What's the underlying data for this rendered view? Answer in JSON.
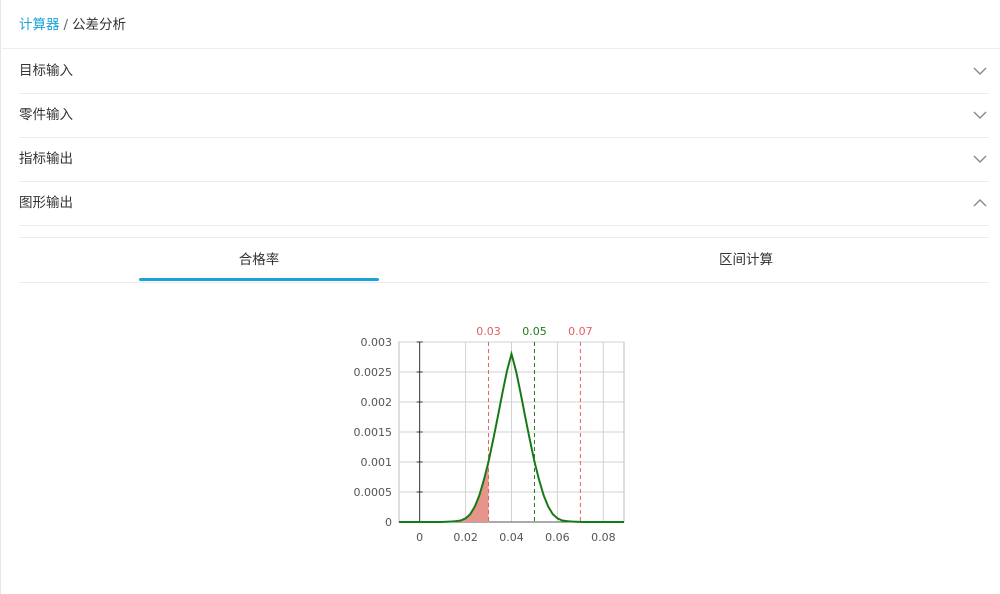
{
  "breadcrumb": {
    "root": "计算器",
    "separator": "/",
    "current": "公差分析"
  },
  "accordion": [
    {
      "label": "目标输入",
      "state": "collapsed"
    },
    {
      "label": "零件输入",
      "state": "collapsed"
    },
    {
      "label": "指标输出",
      "state": "collapsed"
    },
    {
      "label": "图形输出",
      "state": "expanded"
    }
  ],
  "tabs": [
    {
      "label": "合格率",
      "active": true
    },
    {
      "label": "区间计算",
      "active": false
    }
  ],
  "colors": {
    "accent": "#1aa4d6",
    "curve": "#177a17",
    "limit": "#e06060",
    "nominal": "#1f7a1f",
    "fill": "#e6958d"
  },
  "chart_data": {
    "type": "line",
    "title": "",
    "xlabel": "",
    "ylabel": "",
    "xlim": [
      -0.009,
      0.089
    ],
    "ylim": [
      0,
      0.003
    ],
    "x_ticks": [
      "0",
      "0.02",
      "0.04",
      "0.06",
      "0.08"
    ],
    "x_tick_values": [
      0,
      0.02,
      0.04,
      0.06,
      0.08
    ],
    "y_ticks": [
      "0",
      "0.0005",
      "0.001",
      "0.0015",
      "0.002",
      "0.0025",
      "0.003"
    ],
    "y_tick_values": [
      0,
      0.0005,
      0.001,
      0.0015,
      0.002,
      0.0025,
      0.003
    ],
    "grid": true,
    "series": [
      {
        "x": [
          -0.009,
          0.0,
          0.01,
          0.015,
          0.018,
          0.02,
          0.022,
          0.024,
          0.026,
          0.028,
          0.03,
          0.032,
          0.034,
          0.036,
          0.038,
          0.04,
          0.042,
          0.044,
          0.046,
          0.048,
          0.05,
          0.052,
          0.054,
          0.056,
          0.058,
          0.06,
          0.062,
          0.065,
          0.07,
          0.08,
          0.089
        ],
        "y": [
          0,
          0,
          1e-06,
          1e-05,
          2.6e-05,
          6.1e-05,
          0.000129,
          0.000256,
          0.000444,
          0.000704,
          0.001007,
          0.001368,
          0.001747,
          0.002143,
          0.002513,
          0.0028,
          0.002513,
          0.002143,
          0.001747,
          0.001368,
          0.001007,
          0.000704,
          0.000444,
          0.000256,
          0.000129,
          6.1e-05,
          2.6e-05,
          1e-05,
          1e-06,
          0,
          0
        ]
      }
    ],
    "reference_lines": [
      {
        "label": "0.03",
        "x": 0.03,
        "kind": "limit"
      },
      {
        "label": "0.05",
        "x": 0.05,
        "kind": "nominal"
      },
      {
        "label": "0.07",
        "x": 0.07,
        "kind": "limit"
      }
    ],
    "shaded_region": {
      "from": -0.009,
      "to": 0.03
    }
  }
}
